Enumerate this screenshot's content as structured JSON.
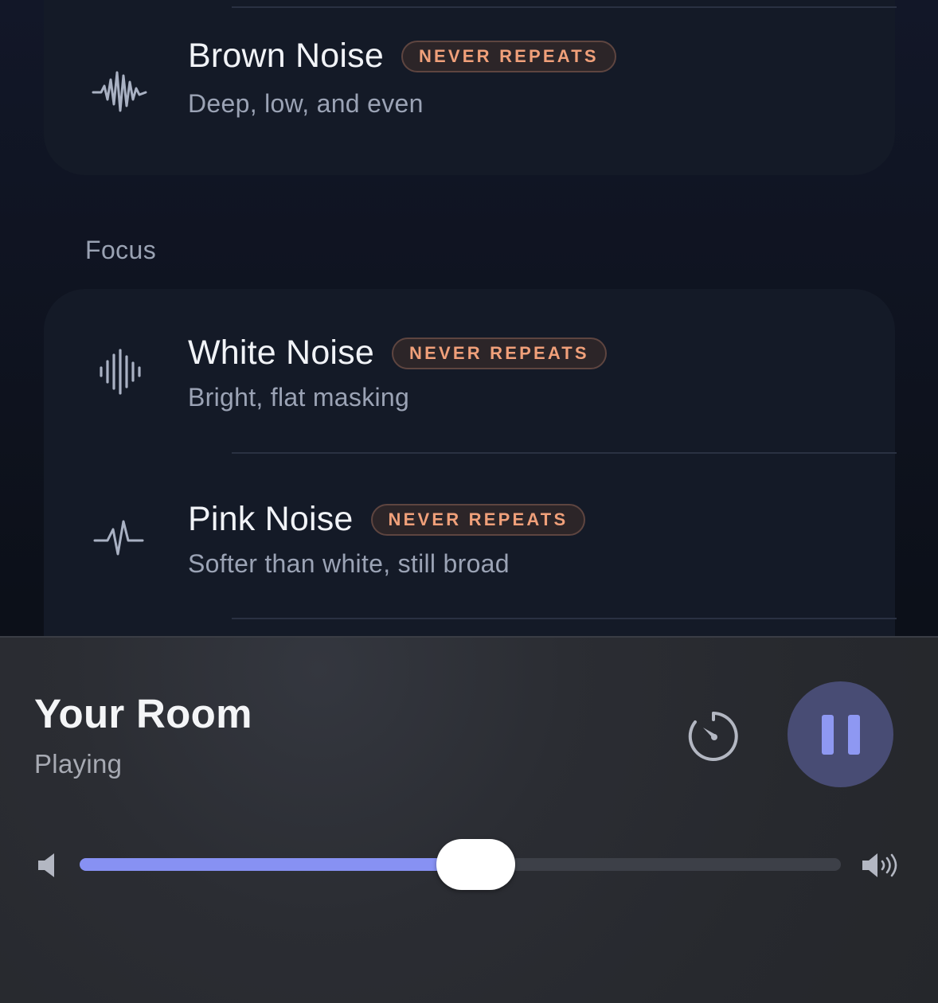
{
  "sounds_top": [
    {
      "title": "Brown Noise",
      "badge": "NEVER REPEATS",
      "subtitle": "Deep, low, and even",
      "icon": "waveform-burst-icon"
    }
  ],
  "focus_section": {
    "label": "Focus",
    "items": [
      {
        "title": "White Noise",
        "badge": "NEVER REPEATS",
        "subtitle": "Bright, flat masking",
        "icon": "waveform-bars-icon"
      },
      {
        "title": "Pink Noise",
        "badge": "NEVER REPEATS",
        "subtitle": "Softer than white, still broad",
        "icon": "pulse-icon"
      }
    ]
  },
  "player": {
    "title": "Your Room",
    "status": "Playing",
    "timer_icon": "timer-icon",
    "pause_icon": "pause-icon",
    "volume_percent": 52
  },
  "colors": {
    "accent": "#8791f3",
    "badge_text": "#f0a07a",
    "pause_button_bg": "#484c74"
  }
}
